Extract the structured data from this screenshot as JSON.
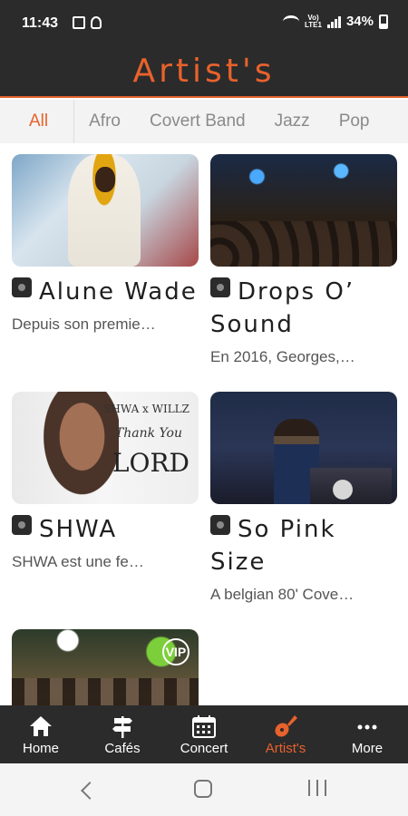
{
  "status_bar": {
    "time": "11:43",
    "network": "VoLTE",
    "battery": "34%"
  },
  "app": {
    "title": "Artist's",
    "accent_color": "#e8622c",
    "header_bg": "#2b2b2b"
  },
  "tabs": [
    {
      "label": "All",
      "active": true
    },
    {
      "label": "Afro",
      "active": false
    },
    {
      "label": "Covert Band",
      "active": false
    },
    {
      "label": "Jazz",
      "active": false
    },
    {
      "label": "Pop",
      "active": false
    }
  ],
  "artists": [
    {
      "name": "Alune Wade",
      "description": "Depuis son premie…",
      "image": "alune-wade-photo"
    },
    {
      "name": "Drops O’ Sound",
      "description": "En 2016, Georges,…",
      "image": "drops-o-sound-photo"
    },
    {
      "name": "SHWA",
      "description": "SHWA est une fe…",
      "image": "shwa-cover-thank-you-lord",
      "image_text": {
        "line1": "SHWA x WILLZ",
        "line2": "Thank You",
        "line3": "LORD"
      }
    },
    {
      "name": "So Pink Size",
      "description": "A belgian 80' Cove…",
      "image": "so-pink-size-photo"
    },
    {
      "name": "",
      "description": "",
      "image": "band-live-photo",
      "image_text": {
        "logo": "VIP"
      }
    }
  ],
  "bottom_nav": [
    {
      "label": "Home",
      "icon": "home-icon",
      "active": false
    },
    {
      "label": "Cafés",
      "icon": "signpost-icon",
      "active": false
    },
    {
      "label": "Concert",
      "icon": "calendar-icon",
      "active": false
    },
    {
      "label": "Artist's",
      "icon": "guitar-icon",
      "active": true
    },
    {
      "label": "More",
      "icon": "more-dots-icon",
      "active": false
    }
  ]
}
